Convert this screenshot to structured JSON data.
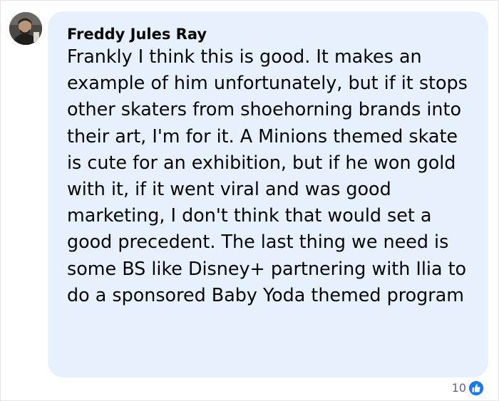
{
  "comment": {
    "author": "Freddy Jules Ray",
    "text": "Frankly I think this is good. It makes an example of him unfortunately, but if it stops other skaters from shoehorning brands into their art, I'm for it. A Minions themed skate is cute for an exhibition, but if he won gold with it, if it went viral and was good marketing, I don't think that would set a good precedent. The last thing we need is some BS like Disney+ partnering with Ilia to do a sponsored Baby Yoda themed program",
    "reaction_count": "10",
    "reaction_icon": "like-icon"
  },
  "colors": {
    "bubble_background": "#e7f0fd",
    "text": "#050505",
    "like_blue": "#1877f2",
    "meta_gray": "#65676b"
  }
}
